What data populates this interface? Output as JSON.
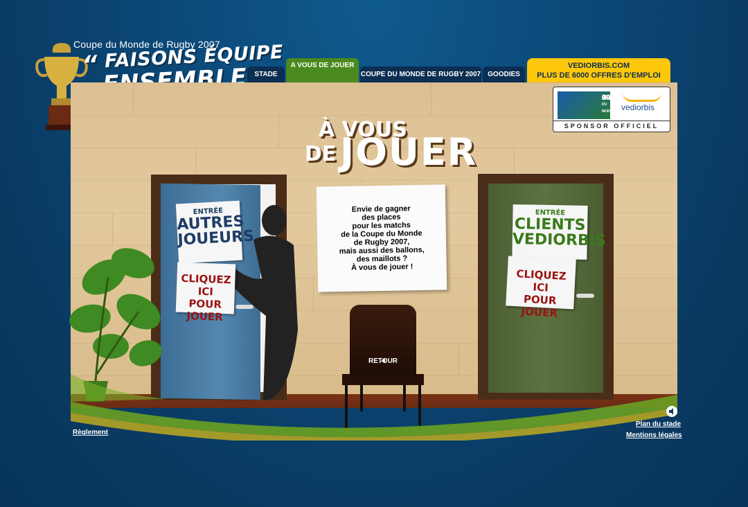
{
  "header": {
    "subtitle": "Coupe du Monde de Rugby 2007",
    "slogan_line1": "FAISONS ÉQUIPE",
    "slogan_line2": "ENSEMBLE"
  },
  "nav": {
    "stade": "STADE",
    "a_vous": "A VOUS DE JOUER",
    "coupe": "COUPE DU MONDE DE RUGBY 2007",
    "goodies": "GOODIES",
    "vedi_line1": "VEDIORBIS.COM",
    "vedi_line2_a": "PLUS DE",
    "vedi_line2_b": "6000 OFFRES D'EMPLOI"
  },
  "sponsor": {
    "irb": "IRB",
    "rugby": "RUGBY",
    "coupe": "COUPE DU MONDE",
    "year": "2007",
    "brand": "vediorbis",
    "label": "SPONSOR OFFICIEL"
  },
  "title": {
    "line1": "À VOUS",
    "line2a": "DE",
    "line2b": "JOUER"
  },
  "left_door": {
    "entree": "ENTRÉE",
    "line1": "AUTRES",
    "line2": "JOUEURS",
    "cta1": "CLIQUEZ ICI",
    "cta2": "POUR JOUER"
  },
  "right_door": {
    "entree": "ENTRÉE",
    "line1": "CLIENTS",
    "line2": "VEDIORBIS",
    "cta1": "CLIQUEZ ICI",
    "cta2": "POUR JOUER"
  },
  "center_card": {
    "text": "Envie de gagner\ndes places\npour les matchs\nde la Coupe du Monde\nde Rugby 2007,\nmais aussi des ballons,\ndes maillots ?\nÀ vous de jouer !"
  },
  "chair": {
    "retour": "RETOUR"
  },
  "footer": {
    "reglement": "Règlement",
    "plan": "Plan du stade",
    "mentions": "Mentions légales"
  },
  "colors": {
    "background": "#0b4674",
    "nav_dark": "#0b2e52",
    "nav_active": "#4a8a1e",
    "nav_yellow": "#ffc70a"
  }
}
